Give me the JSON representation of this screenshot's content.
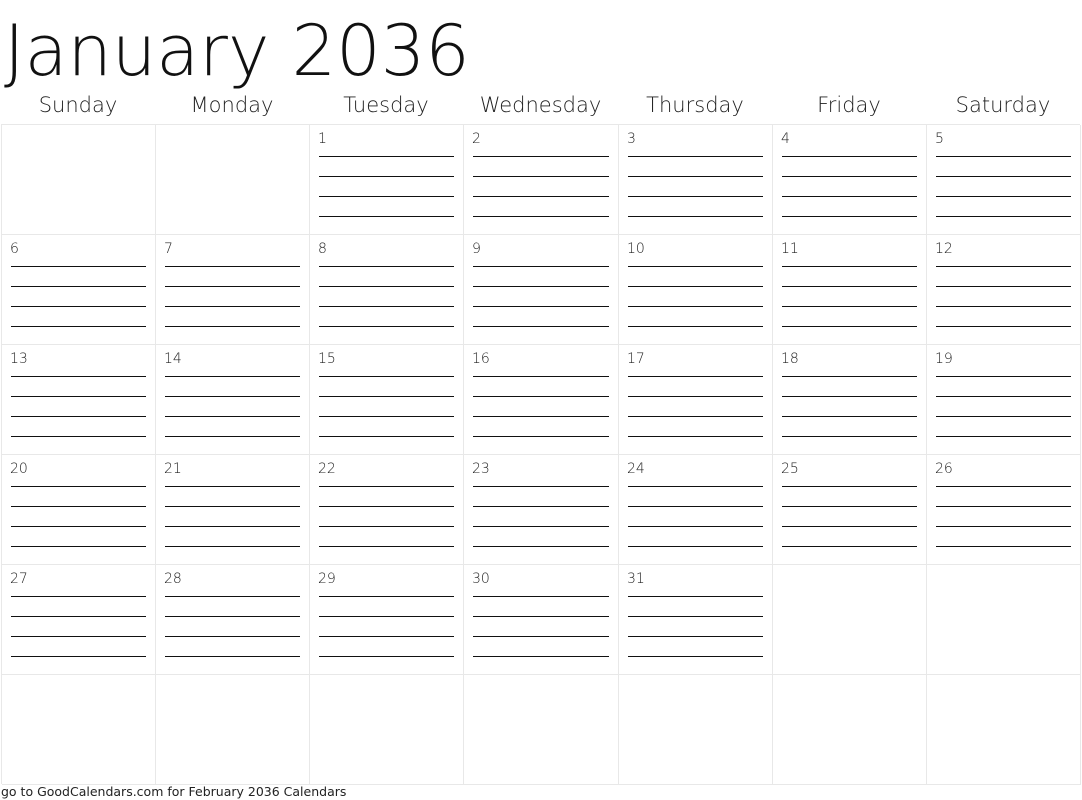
{
  "title": "January 2036",
  "weekdays": [
    "Sunday",
    "Monday",
    "Tuesday",
    "Wednesday",
    "Thursday",
    "Friday",
    "Saturday"
  ],
  "weeks": [
    [
      "",
      "",
      "1",
      "2",
      "3",
      "4",
      "5"
    ],
    [
      "6",
      "7",
      "8",
      "9",
      "10",
      "11",
      "12"
    ],
    [
      "13",
      "14",
      "15",
      "16",
      "17",
      "18",
      "19"
    ],
    [
      "20",
      "21",
      "22",
      "23",
      "24",
      "25",
      "26"
    ],
    [
      "27",
      "28",
      "29",
      "30",
      "31",
      "",
      ""
    ],
    [
      "",
      "",
      "",
      "",
      "",
      "",
      ""
    ]
  ],
  "writing_lines_per_day": 4,
  "footer": "go to GoodCalendars.com for February 2036 Calendars"
}
